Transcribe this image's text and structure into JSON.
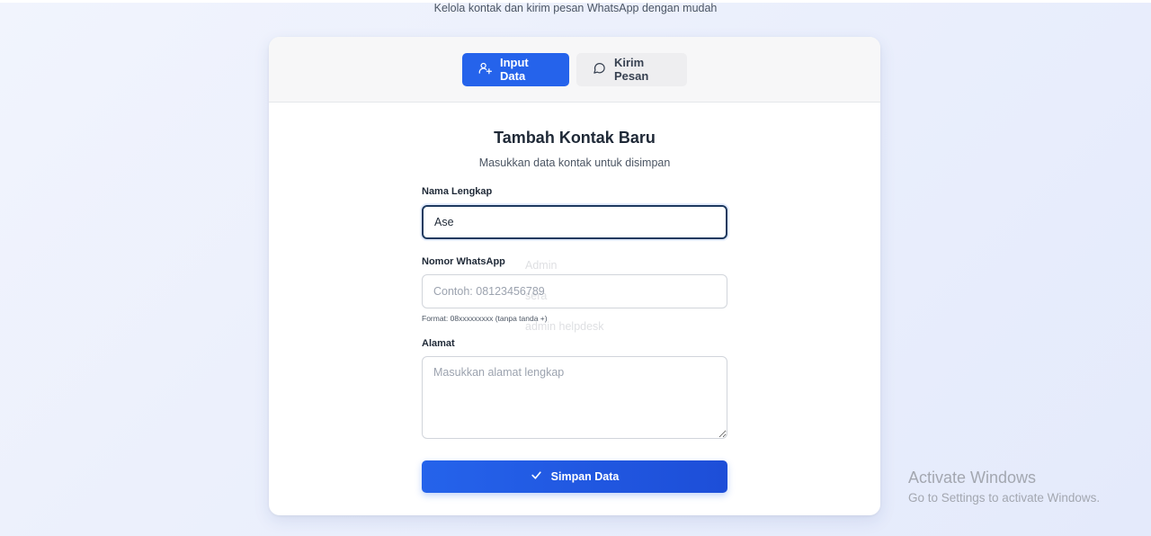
{
  "header": {
    "subtitle": "Kelola kontak dan kirim pesan WhatsApp dengan mudah"
  },
  "tabs": [
    {
      "label": "Input Data",
      "icon": "user-plus-icon",
      "active": true
    },
    {
      "label": "Kirim Pesan",
      "icon": "message-circle-icon",
      "active": false
    }
  ],
  "form": {
    "title": "Tambah Kontak Baru",
    "description": "Masukkan data kontak untuk disimpan",
    "name": {
      "label": "Nama Lengkap",
      "value": "Ase"
    },
    "phone": {
      "label": "Nomor WhatsApp",
      "placeholder": "Contoh: 08123456789",
      "hint": "Format: 08xxxxxxxxx (tanpa tanda +)"
    },
    "address": {
      "label": "Alamat",
      "placeholder": "Masukkan alamat lengkap"
    },
    "submit": {
      "label": "Simpan Data",
      "icon": "check-icon"
    }
  },
  "autofill_suggestions": [
    "Admin",
    "sera",
    "admin helpdesk"
  ],
  "watermark": {
    "title": "Activate Windows",
    "subtitle": "Go to Settings to activate Windows."
  },
  "colors": {
    "accent": "#2563eb",
    "focus_border": "#1e3a5f",
    "page_bg": "#eef2fc"
  }
}
